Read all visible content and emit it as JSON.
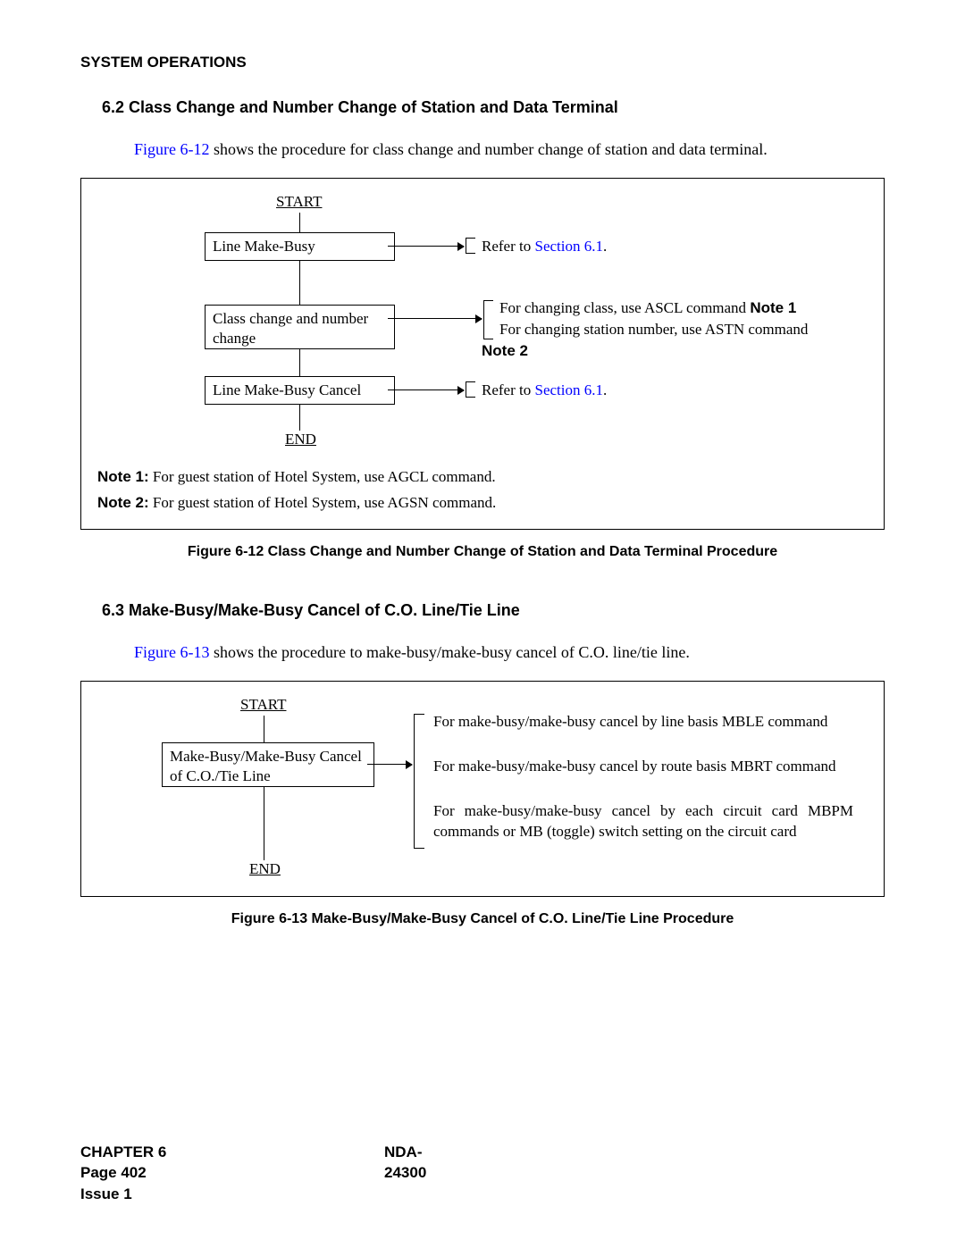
{
  "header": "SYSTEM OPERATIONS",
  "section_62": {
    "heading": "6.2  Class Change and Number Change of Station and Data Terminal",
    "intro_link": "Figure 6-12",
    "intro_rest": " shows the procedure for class change and number change of station and data terminal.",
    "flow": {
      "start": "START",
      "box1": "Line Make-Busy",
      "side1_pre": "Refer to ",
      "side1_link": "Section 6.1",
      "side1_post": ".",
      "box2": "Class change and number change",
      "side2a_pre": "For changing class, use ASCL command ",
      "side2a_note": "Note 1",
      "side2b": "For changing station number, use ASTN command",
      "side2_note2": "Note 2",
      "box3": "Line Make-Busy Cancel",
      "side3_pre": "Refer to ",
      "side3_link": "Section 6.1",
      "side3_post": ".",
      "end": "END"
    },
    "note1_label": "Note 1:",
    "note1_text": " For guest station of Hotel System, use AGCL command.",
    "note2_label": "Note 2:",
    "note2_text": " For guest station of Hotel System, use AGSN command.",
    "caption": "Figure 6-12   Class Change and Number Change of Station and Data Terminal Procedure"
  },
  "section_63": {
    "heading": "6.3  Make-Busy/Make-Busy Cancel of C.O. Line/Tie Line",
    "intro_link": "Figure 6-13",
    "intro_rest": " shows the procedure to make-busy/make-busy cancel of C.O. line/tie line.",
    "flow": {
      "start": "START",
      "box1": "Make-Busy/Make-Busy Cancel of C.O./Tie Line",
      "side_a": "For make-busy/make-busy cancel by line basis MBLE command",
      "side_b": "For make-busy/make-busy cancel by route basis MBRT command",
      "side_c": "For make-busy/make-busy cancel by each circuit card MBPM commands or MB (toggle) switch setting on the circuit card",
      "end": "END"
    },
    "caption": "Figure 6-13   Make-Busy/Make-Busy Cancel of C.O. Line/Tie Line Procedure"
  },
  "footer": {
    "chapter": "CHAPTER 6",
    "page": "Page 402",
    "issue": "Issue 1",
    "doc": "NDA-24300"
  }
}
